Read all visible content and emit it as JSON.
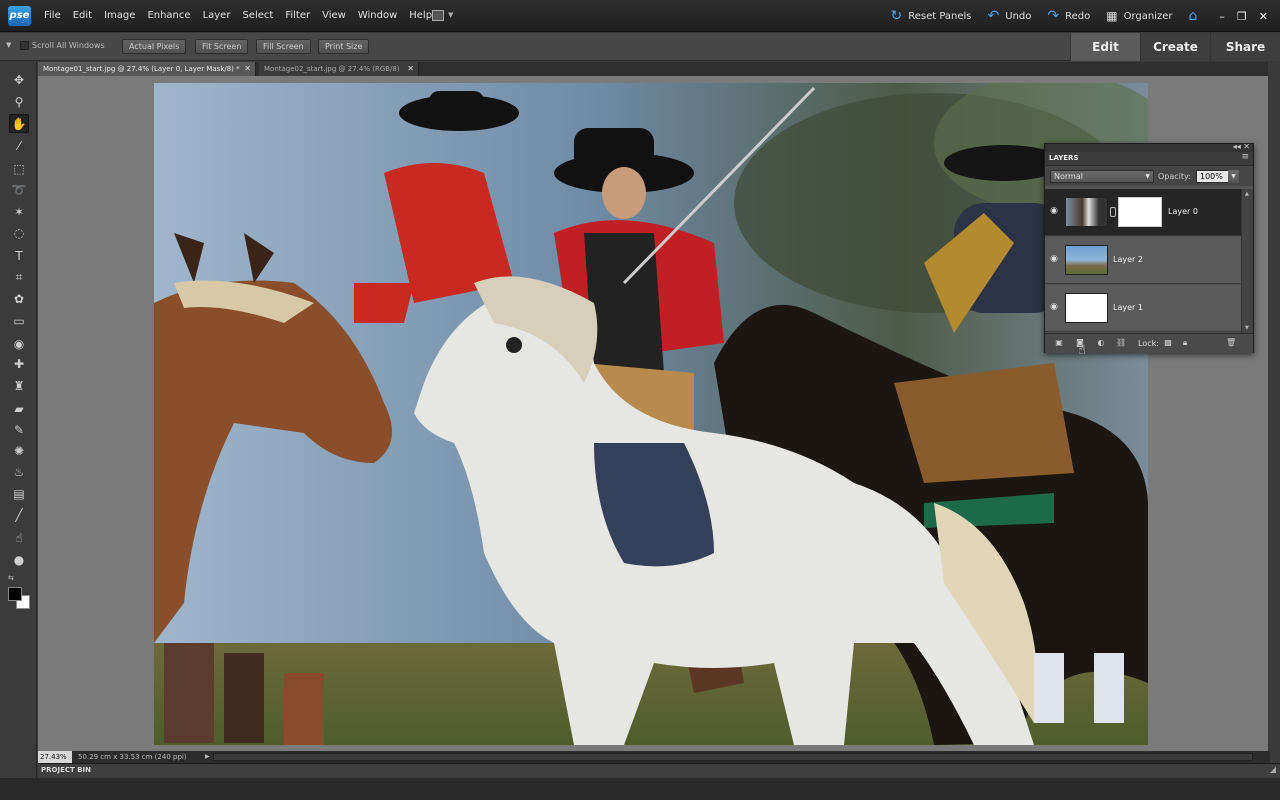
{
  "app": {
    "logo": "pse"
  },
  "menu": [
    "File",
    "Edit",
    "Image",
    "Enhance",
    "Layer",
    "Select",
    "Filter",
    "View",
    "Window",
    "Help"
  ],
  "topright": {
    "reset_panels": "Reset Panels",
    "undo": "Undo",
    "redo": "Redo",
    "organizer": "Organizer"
  },
  "options": {
    "scroll_all": "Scroll All Windows",
    "actual_pixels": "Actual Pixels",
    "fit_screen": "Fit Screen",
    "fill_screen": "Fill Screen",
    "print_size": "Print Size"
  },
  "modes": {
    "edit": "Edit",
    "create": "Create",
    "share": "Share"
  },
  "doc_tabs": [
    {
      "label": "Montage01_start.jpg @ 27.4% (Layer 0, Layer Mask/8) *"
    },
    {
      "label": "Montage02_start.jpg @ 27.4% (RGB/8)"
    }
  ],
  "status": {
    "zoom": "27.43%",
    "doc_size": "50.29 cm x 33.53 cm (240 ppi)"
  },
  "project_bin": "PROJECT BIN",
  "layers_panel": {
    "title": "LAYERS",
    "blend_mode": "Normal",
    "opacity_label": "Opacity:",
    "opacity": "100%",
    "lock_label": "Lock:",
    "layers": [
      {
        "name": "Layer 0"
      },
      {
        "name": "Layer 2"
      },
      {
        "name": "Layer 1"
      }
    ]
  },
  "icons": {
    "tools": [
      "move-tool-icon",
      "zoom-tool-icon",
      "hand-tool-icon",
      "eyedropper-tool-icon",
      "marquee-tool-icon",
      "lasso-tool-icon",
      "magic-wand-tool-icon",
      "quick-selection-tool-icon",
      "type-tool-icon",
      "crop-tool-icon",
      "cookie-cutter-tool-icon",
      "straighten-tool-icon",
      "red-eye-tool-icon",
      "spot-healing-tool-icon",
      "clone-stamp-tool-icon",
      "eraser-tool-icon",
      "brush-tool-icon",
      "smart-brush-tool-icon",
      "paint-bucket-tool-icon",
      "gradient-tool-icon",
      "pencil-tool-icon",
      "smudge-tool-icon",
      "sponge-tool-icon"
    ]
  }
}
